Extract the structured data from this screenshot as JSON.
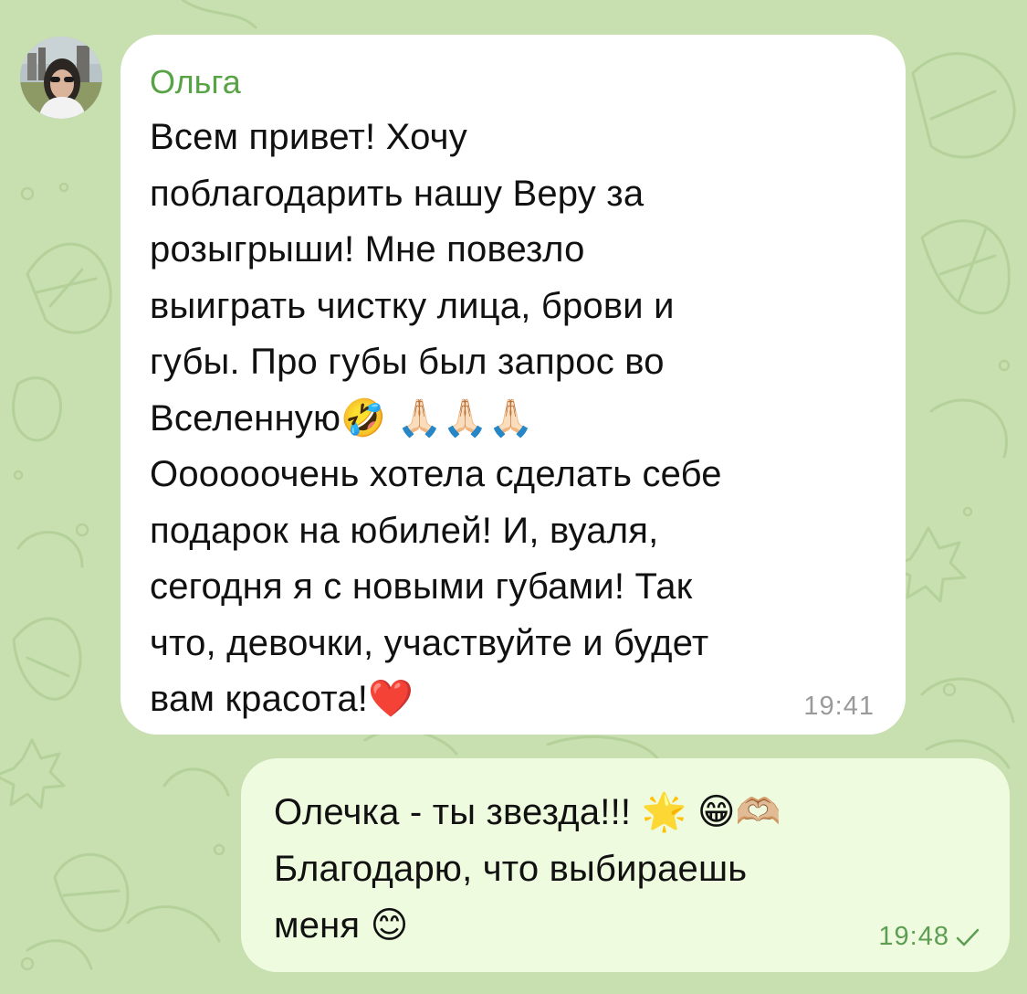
{
  "messages": {
    "incoming": {
      "sender": "Ольга",
      "text": "Всем привет! Хочу\nпоблагодарить нашу Веру за\nрозыгрыши! Мне повезло\nвыиграть чистку лица, брови и\nгубы.  Про губы был запрос во\nВселенную🤣 🙏🏻🙏🏻🙏🏻\nОооооочень хотела сделать себе\nподарок на юбилей! И, вуаля,\nсегодня я с новыми губами! Так\nчто, девочки, участвуйте и будет\nвам красота!❤️",
      "time": "19:41"
    },
    "outgoing": {
      "text": "Олечка - ты звезда!!! 🌟 😁🫶🏼\nБлагодарю, что выбираешь\nменя 😊",
      "time": "19:48",
      "status_icon": "check-icon"
    }
  },
  "colors": {
    "wallpaper": "#c8dfb0",
    "incoming_bubble": "#ffffff",
    "outgoing_bubble": "#eefbdf",
    "sender_name": "#57a346",
    "outgoing_time": "#5e9e53"
  }
}
